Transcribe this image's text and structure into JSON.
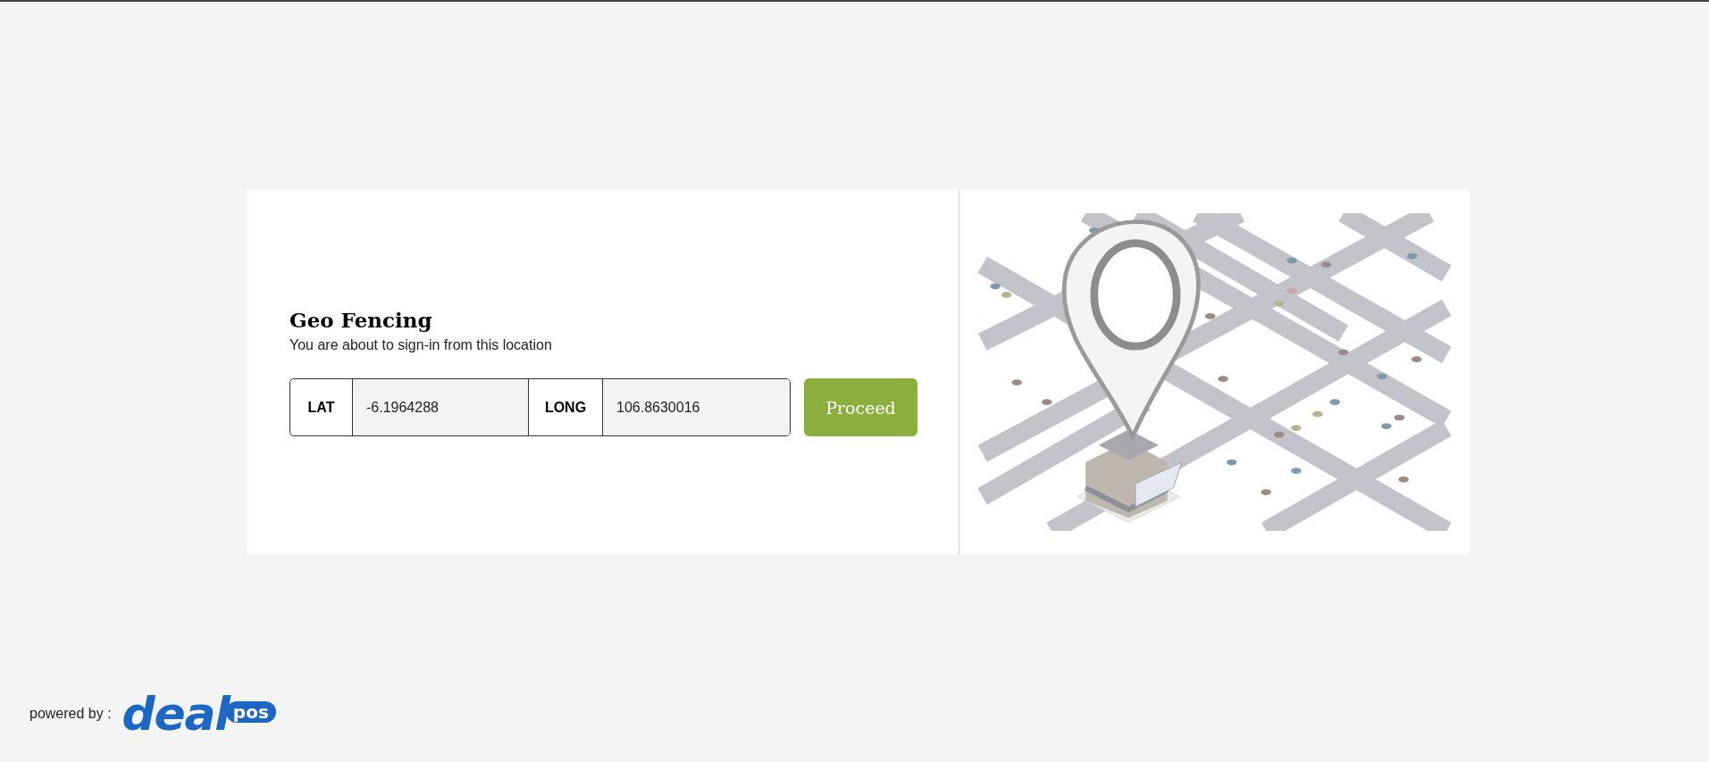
{
  "card": {
    "title": "Geo Fencing",
    "subtitle": "You are about to sign-in from this location",
    "fields": [
      {
        "label": "LAT",
        "value": "-6.1964288"
      },
      {
        "label": "LONG",
        "value": "106.8630016"
      }
    ],
    "button": "Proceed"
  },
  "footer": {
    "powered_by": "powered by :",
    "logo": {
      "word": "deal",
      "badge": "pos"
    }
  }
}
